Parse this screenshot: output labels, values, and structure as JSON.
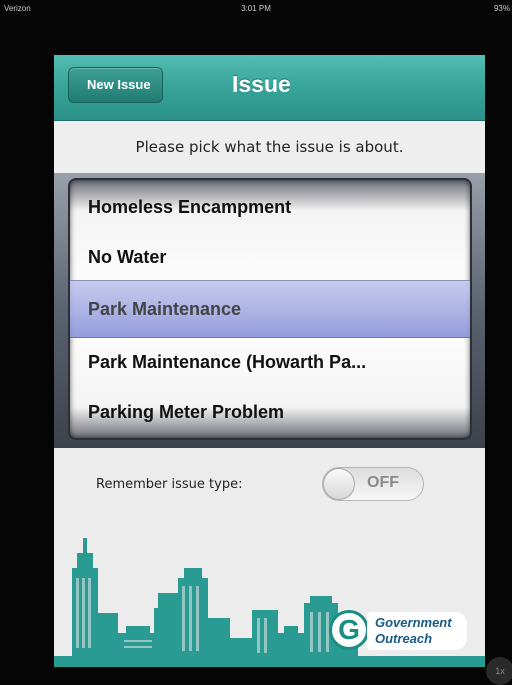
{
  "status_bar": {
    "carrier": "Verizon",
    "time": "3:01 PM",
    "battery": "93%"
  },
  "nav": {
    "back_label": "New Issue",
    "title": "Issue"
  },
  "prompt": "Please pick what the issue is about.",
  "picker": {
    "options": [
      "Homeless Encampment",
      "No Water",
      "Park Maintenance",
      "Park Maintenance (Howarth Pa...",
      "Parking Meter Problem"
    ],
    "selected": "Park Maintenance"
  },
  "remember": {
    "label": "Remember issue type:",
    "toggle_state": "OFF"
  },
  "footer": {
    "logo_line1": "Government",
    "logo_line2": "Outreach"
  },
  "zoom_badge": "1x",
  "colors": {
    "accent_teal": "#3aa69c",
    "skyline_teal": "#2a9b92"
  }
}
